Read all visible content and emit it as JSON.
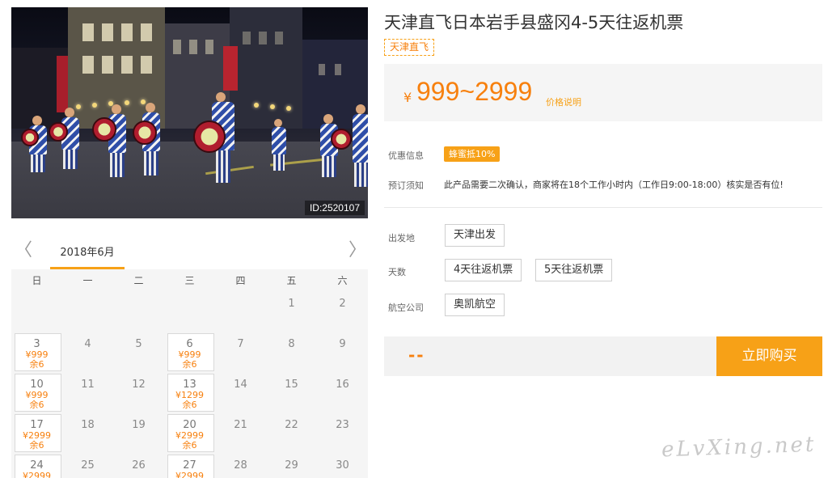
{
  "photo": {
    "id_label": "ID:2520107"
  },
  "product": {
    "title": "天津直飞日本岩手县盛冈4-5天往返机票",
    "tag": "天津直飞",
    "currency": "¥",
    "price_range": "999~2999",
    "price_note": "价格说明"
  },
  "info": {
    "promo_label": "优惠信息",
    "promo_badge": "蜂蜜抵10%",
    "notice_label": "预订须知",
    "notice_text": "此产品需要二次确认，商家将在18个工作小时内（工作日9:00-18:00）核实是否有位!"
  },
  "options": {
    "departure_label": "出发地",
    "departure": [
      "天津出发"
    ],
    "days_label": "天数",
    "days": [
      "4天往返机票",
      "5天往返机票"
    ],
    "airline_label": "航空公司",
    "airline": [
      "奥凯航空"
    ]
  },
  "buy": {
    "total": "--",
    "button": "立即购买"
  },
  "calendar": {
    "prev": "〈",
    "next": "〉",
    "month": "2018年6月",
    "weekdays": [
      "日",
      "一",
      "二",
      "三",
      "四",
      "五",
      "六"
    ],
    "days": [
      {
        "d": ""
      },
      {
        "d": ""
      },
      {
        "d": ""
      },
      {
        "d": ""
      },
      {
        "d": ""
      },
      {
        "d": "1"
      },
      {
        "d": "2"
      },
      {
        "d": "3",
        "price": "¥999",
        "left": "余6"
      },
      {
        "d": "4"
      },
      {
        "d": "5"
      },
      {
        "d": "6",
        "price": "¥999",
        "left": "余6"
      },
      {
        "d": "7"
      },
      {
        "d": "8"
      },
      {
        "d": "9"
      },
      {
        "d": "10",
        "price": "¥999",
        "left": "余6"
      },
      {
        "d": "11"
      },
      {
        "d": "12"
      },
      {
        "d": "13",
        "price": "¥1299",
        "left": "余6"
      },
      {
        "d": "14"
      },
      {
        "d": "15"
      },
      {
        "d": "16"
      },
      {
        "d": "17",
        "price": "¥2999",
        "left": "余6"
      },
      {
        "d": "18"
      },
      {
        "d": "19"
      },
      {
        "d": "20",
        "price": "¥2999",
        "left": "余6"
      },
      {
        "d": "21"
      },
      {
        "d": "22"
      },
      {
        "d": "23"
      },
      {
        "d": "24",
        "price": "¥2999"
      },
      {
        "d": "25"
      },
      {
        "d": "26"
      },
      {
        "d": "27",
        "price": "¥2999"
      },
      {
        "d": "28"
      },
      {
        "d": "29"
      },
      {
        "d": "30"
      }
    ]
  },
  "watermark": "eLvXing.net"
}
